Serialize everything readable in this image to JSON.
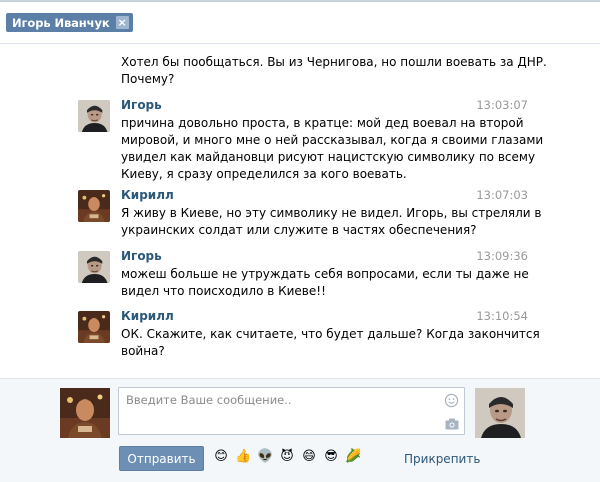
{
  "header": {
    "tab_label": "Игорь Иванчук",
    "close_glyph": "×"
  },
  "messages": [
    {
      "author": "",
      "time": "",
      "avatar": "none",
      "lines": [
        "Хотел бы пообщаться. Вы из Чернигова, но пошли воевать за ДНР.",
        "Почему?"
      ]
    },
    {
      "author": "Игорь",
      "time": "13:03:07",
      "avatar": "igor",
      "lines": [
        "причина довольно проста, в кратце: мой дед воевал на второй",
        "мировой, и много мне о ней рассказывал, когда я своими глазами",
        "увидел как майдановци рисуют нацистскую символику по всему",
        "Киеву, я сразу определился за кого воевать."
      ]
    },
    {
      "author": "Кирилл",
      "time": "13:07:03",
      "avatar": "kirill",
      "lines": [
        "Я живу в Киеве, но эту символику не видел. Игорь, вы стреляли в",
        "украинских солдат или служите в частях обеспечения?"
      ]
    },
    {
      "author": "Игорь",
      "time": "13:09:36",
      "avatar": "igor",
      "lines": [
        "можеш больше не утруждать себя вопросами, если ты даже не",
        "видел что поисходило в Киеве!!"
      ]
    },
    {
      "author": "Кирилл",
      "time": "13:10:54",
      "avatar": "kirill",
      "lines": [
        "ОК. Скажите, как считаете, что будет дальше? Когда закончится",
        "война?"
      ]
    }
  ],
  "composer": {
    "placeholder": "Введите Ваше сообщение..",
    "value": "",
    "send_label": "Отправить",
    "attach_label": "Прикрепить",
    "emojis": [
      {
        "name": "smile-emoji",
        "glyph": "😊"
      },
      {
        "name": "thumbs-up-emoji",
        "glyph": "👍"
      },
      {
        "name": "alien-emoji",
        "glyph": "👽"
      },
      {
        "name": "devil-emoji",
        "glyph": "😈"
      },
      {
        "name": "grin-emoji",
        "glyph": "😄"
      },
      {
        "name": "sunglasses-emoji",
        "glyph": "😎"
      },
      {
        "name": "corn-emoji",
        "glyph": "🌽"
      }
    ]
  },
  "colors": {
    "accent": "#5b7fa6",
    "link": "#2b587a",
    "button": "#6d8fb3",
    "timestamp": "#999999"
  }
}
